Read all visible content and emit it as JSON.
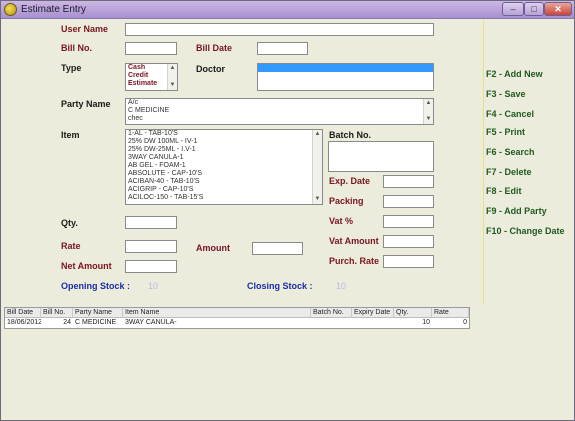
{
  "window": {
    "title": "Estimate Entry",
    "minimize": "–",
    "maximize": "□",
    "close": "✕"
  },
  "form": {
    "user_name": {
      "label": "User Name",
      "value": ""
    },
    "bill_no": {
      "label": "Bill No.",
      "value": ""
    },
    "bill_date": {
      "label": "Bill Date",
      "value": ""
    },
    "type": {
      "label": "Type",
      "options": [
        "Cash",
        "Credit",
        "Estimate"
      ]
    },
    "doctor": {
      "label": "Doctor"
    },
    "party_name": {
      "label": "Party Name",
      "items": [
        "A/c",
        "C MEDICINE",
        "chec"
      ]
    },
    "item": {
      "label": "Item",
      "items": [
        "1-AL - TAB-10'S",
        "25% DW 100ML - IV-1",
        "25% DW-25ML - I.V-1",
        "3WAY CANULA-1",
        "AB GEL - FOAM-1",
        "ABSOLUTE - CAP-10'S",
        "ACIBAN-40 - TAB-10'S",
        "ACIGRIP - CAP-10'S",
        "ACILOC-150 - TAB-15'S"
      ]
    },
    "batch_no": {
      "label": "Batch No."
    },
    "exp_date": {
      "label": "Exp. Date"
    },
    "packing": {
      "label": "Packing"
    },
    "vat_percent": {
      "label": "Vat %"
    },
    "vat_amount": {
      "label": "Vat Amount"
    },
    "purch_rate": {
      "label": "Purch. Rate"
    },
    "qty": {
      "label": "Qty."
    },
    "rate": {
      "label": "Rate"
    },
    "amount": {
      "label": "Amount"
    },
    "net_amount": {
      "label": "Net Amount"
    },
    "opening_stock": {
      "label": "Opening Stock :",
      "value": "10"
    },
    "closing_stock": {
      "label": "Closing Stock :",
      "value": "10"
    }
  },
  "shortcuts": [
    "F2 - Add New",
    "F3 - Save",
    "F4 - Cancel",
    "F5 - Print",
    "F6 - Search",
    "F7 - Delete",
    "F8 - Edit",
    "F9 - Add Party",
    "F10 - Change Date"
  ],
  "grid": {
    "columns": [
      "Bill Date",
      "Bill No.",
      "Party Name",
      "Item Name",
      "Batch No.",
      "Expiry Date",
      "Qty.",
      "Rate"
    ],
    "rows": [
      {
        "bill_date": "18/06/2012",
        "bill_no": "24",
        "party_name": "C MEDICINE",
        "item_name": "3WAY CANULA-",
        "batch_no": "",
        "expiry_date": "",
        "qty": "10",
        "rate": "0"
      }
    ]
  },
  "colors": {
    "label_maroon": "#7a1420",
    "shortcut_green": "#1f5a1f",
    "stock_blue": "#1a2ea8",
    "selection_blue": "#3399ff",
    "title_lavender": "#b8a2d8"
  }
}
